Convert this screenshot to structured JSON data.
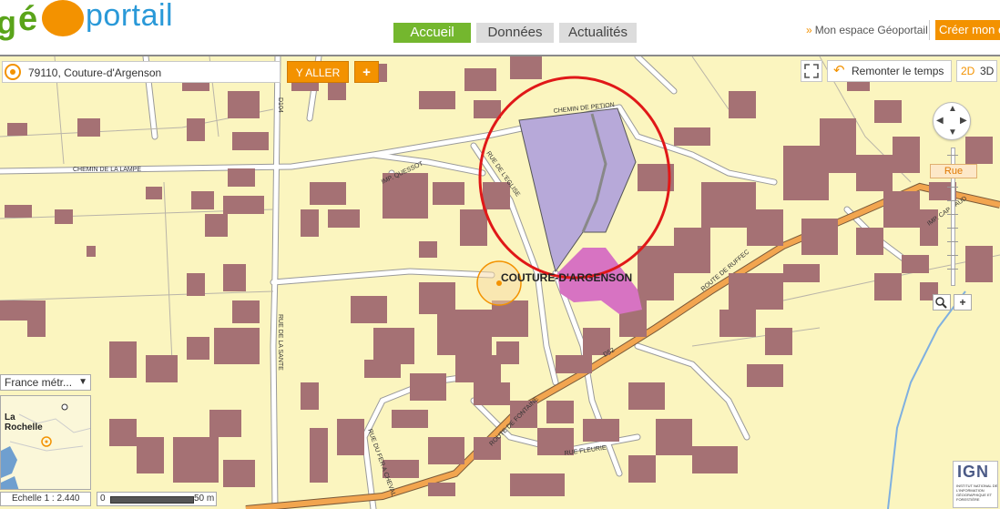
{
  "header": {
    "logo": "géoportail",
    "tabs": [
      {
        "label": "Accueil",
        "active": true
      },
      {
        "label": "Données",
        "active": false
      },
      {
        "label": "Actualités",
        "active": false
      }
    ],
    "espace_link": "Mon espace Géoportail",
    "create_button": "Créer mon e"
  },
  "search": {
    "value": "79110, Couture-d'Argenson",
    "go_label": "Y ALLER",
    "plus_label": "+"
  },
  "controls": {
    "time_label": "Remonter le temps",
    "dim_2d": "2D",
    "dim_3d": "3D",
    "zoom_level_label": "Rue"
  },
  "overview": {
    "territory": "France métr...",
    "city": "La\nRochelle"
  },
  "scale": {
    "ratio": "Echelle 1 : 2.440",
    "zero": "0",
    "distance": "50 m"
  },
  "attribution": {
    "ign": "IGN",
    "ign_subtitle": "INSTITUT NATIONAL DE L'INFORMATION GÉOGRAPHIQUE ET FORESTIÈRE"
  },
  "map": {
    "place_label": "COUTURE-D'ARGENSON",
    "street_labels": [
      "CHEMIN DE PETION",
      "CHEMIN DE LA LAMPE",
      "IMP. QUESSOT",
      "RUE DE L'EGLISE",
      "ROUTE DE RUFFEC",
      "D52",
      "ROUTE DE FONTAINE",
      "RUE FLEURIE",
      "RUE DE LA SANTE",
      "D104",
      "RUE DU FER A CHEVAL",
      "IMP. CAP SAUD"
    ],
    "colors": {
      "background": "#fbf5bf",
      "building": "#a57174",
      "parcel_highlight": "#b7a9d9",
      "parcel_pink": "#d773c2",
      "main_road": "#f2a54f",
      "circle_annotation": "#e01818",
      "water": "#6f9fcf"
    }
  }
}
